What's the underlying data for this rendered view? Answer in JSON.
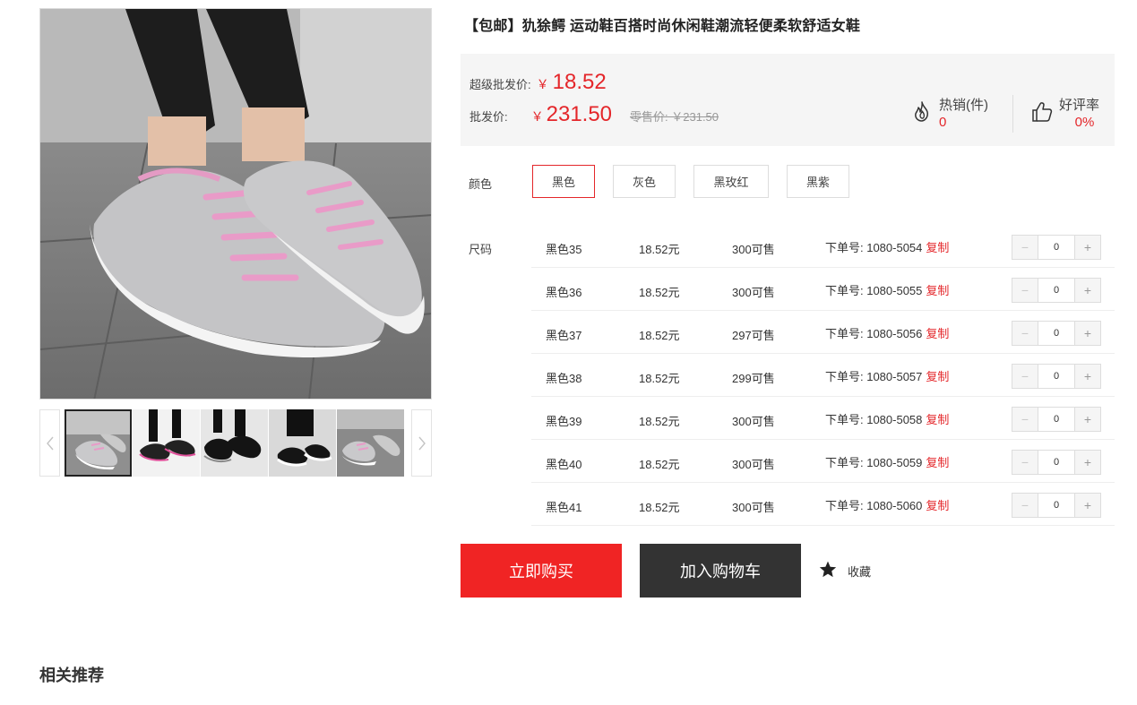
{
  "product": {
    "title": "【包邮】犰狳鳄 运动鞋百搭时尚休闲鞋潮流轻便柔软舒适女鞋"
  },
  "gallery": {
    "main_image": "pink-grey-sneaker-photo",
    "thumbnails": [
      "grey-pink-sneaker",
      "black-pink-sneaker",
      "black-sneaker",
      "black-white-sneaker",
      "grey-pink-sneaker-2"
    ],
    "active_index": 0
  },
  "price": {
    "super_label": "超级批发价:",
    "super_currency": "￥",
    "super_value": "18.52",
    "wholesale_label": "批发价:",
    "wholesale_currency": "￥",
    "wholesale_value": "231.50",
    "retail_text": "零售价: ￥231.50"
  },
  "stats": {
    "hot_label": "热销(件)",
    "hot_value": "0",
    "rating_label": "好评率",
    "rating_value": "0%"
  },
  "color": {
    "label": "颜色",
    "options": [
      "黑色",
      "灰色",
      "黑玫红",
      "黑紫"
    ],
    "selected": "黑色"
  },
  "size": {
    "label": "尺码",
    "copy_label": "复制",
    "rows": [
      {
        "name": "黑色35",
        "price": "18.52元",
        "stock": "300可售",
        "order": "下单号: 1080-5054",
        "qty": "0"
      },
      {
        "name": "黑色36",
        "price": "18.52元",
        "stock": "300可售",
        "order": "下单号: 1080-5055",
        "qty": "0"
      },
      {
        "name": "黑色37",
        "price": "18.52元",
        "stock": "297可售",
        "order": "下单号: 1080-5056",
        "qty": "0"
      },
      {
        "name": "黑色38",
        "price": "18.52元",
        "stock": "299可售",
        "order": "下单号: 1080-5057",
        "qty": "0"
      },
      {
        "name": "黑色39",
        "price": "18.52元",
        "stock": "300可售",
        "order": "下单号: 1080-5058",
        "qty": "0"
      },
      {
        "name": "黑色40",
        "price": "18.52元",
        "stock": "300可售",
        "order": "下单号: 1080-5059",
        "qty": "0"
      },
      {
        "name": "黑色41",
        "price": "18.52元",
        "stock": "300可售",
        "order": "下单号: 1080-5060",
        "qty": "0"
      }
    ]
  },
  "actions": {
    "buy_now": "立即购买",
    "add_to_cart": "加入购物车",
    "favorite": "收藏"
  },
  "related": {
    "title": "相关推荐"
  },
  "colors": {
    "accent_red": "#e4262a",
    "buy_button": "#f02424",
    "cart_button": "#333333",
    "panel_bg": "#f5f5f5"
  }
}
